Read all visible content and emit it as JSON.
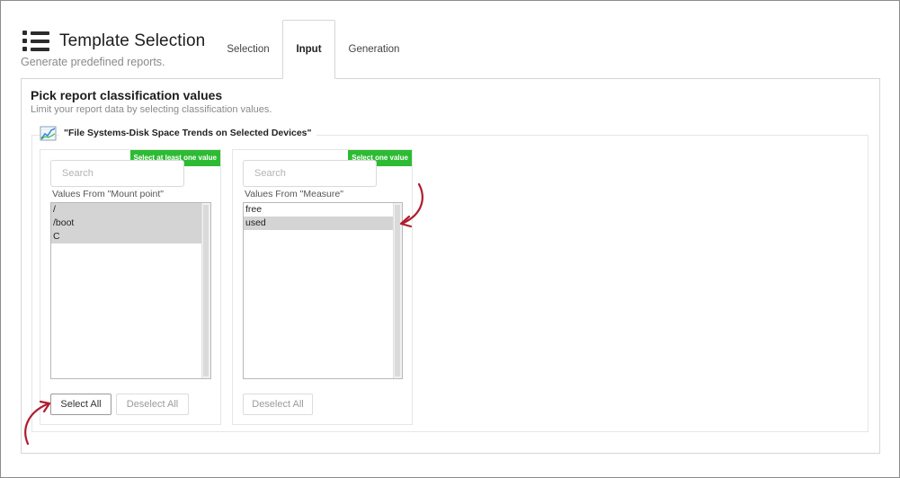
{
  "header": {
    "title": "Template Selection",
    "subtitle": "Generate predefined reports.",
    "menu_icon": "list-menu-icon"
  },
  "tabs": [
    {
      "label": "Selection",
      "active": false
    },
    {
      "label": "Input",
      "active": true
    },
    {
      "label": "Generation",
      "active": false
    }
  ],
  "section": {
    "title": "Pick report classification values",
    "subtitle": "Limit your report data by selecting classification values."
  },
  "report": {
    "title": "\"File Systems-Disk Space Trends on Selected Devices\"",
    "icon": "line-chart-icon"
  },
  "filters": [
    {
      "badge": "Select at least one value",
      "search_placeholder": "Search",
      "label": "Values From \"Mount point\"",
      "options": [
        {
          "text": "/",
          "selected": true
        },
        {
          "text": "/boot",
          "selected": true
        },
        {
          "text": "C",
          "selected": true
        }
      ],
      "select_all_label": "Select All",
      "deselect_all_label": "Deselect All"
    },
    {
      "badge": "Select one value",
      "search_placeholder": "Search",
      "label": "Values From \"Measure\"",
      "options": [
        {
          "text": "free",
          "selected": false
        },
        {
          "text": "used",
          "selected": true
        }
      ],
      "deselect_all_label": "Deselect All"
    }
  ],
  "colors": {
    "badge_green": "#2dbb33",
    "selected_row": "#d4d4d4",
    "annotation_arrow": "#b01c2e"
  }
}
